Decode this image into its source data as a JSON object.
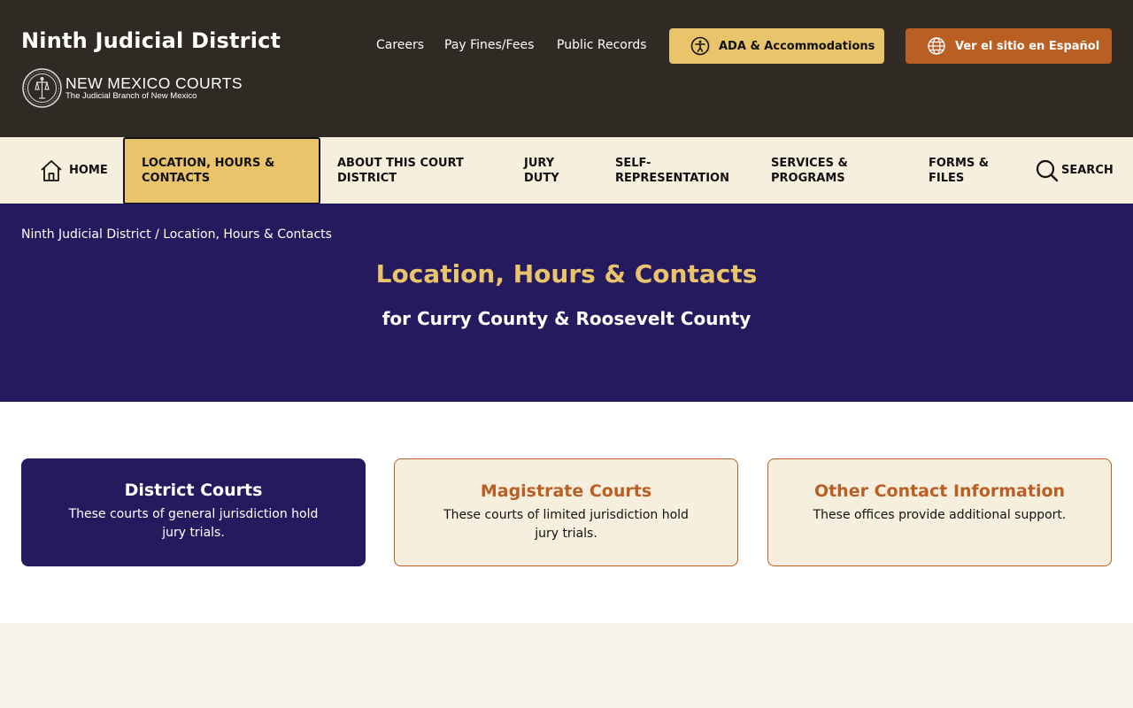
{
  "header": {
    "site_title": "Ninth Judicial District",
    "logo_main": "NEW MEXICO COURTS",
    "logo_sub": "The Judicial Branch of New Mexico",
    "utility_links": [
      "Careers",
      "Pay Fines/Fees",
      "Public Records"
    ],
    "ada_button": "ADA & Accommodations",
    "spanish_button": "Ver el sitio en Español"
  },
  "nav": {
    "home": "HOME",
    "items": [
      "LOCATION, HOURS & CONTACTS",
      "ABOUT THIS COURT DISTRICT",
      "JURY DUTY",
      "SELF-REPRESENTATION",
      "SERVICES & PROGRAMS",
      "FORMS & FILES"
    ],
    "search": "SEARCH"
  },
  "hero": {
    "breadcrumb_root": "Ninth Judicial District",
    "breadcrumb_sep": "/",
    "breadcrumb_current": "Location, Hours & Contacts",
    "title": "Location, Hours & Contacts",
    "subtitle": "for Curry County & Roosevelt County"
  },
  "cards": [
    {
      "title": "District Courts",
      "description": "These courts of general jurisdiction hold jury trials."
    },
    {
      "title": "Magistrate Courts",
      "description": "These courts of limited jurisdiction hold jury trials."
    },
    {
      "title": "Other Contact Information",
      "description": "These offices provide additional support."
    }
  ],
  "colors": {
    "header_bg": "#302a25",
    "nav_bg": "#f7efde",
    "accent_gold": "#e9c46a",
    "accent_orange": "#b95f24",
    "hero_bg": "#261a5e"
  }
}
